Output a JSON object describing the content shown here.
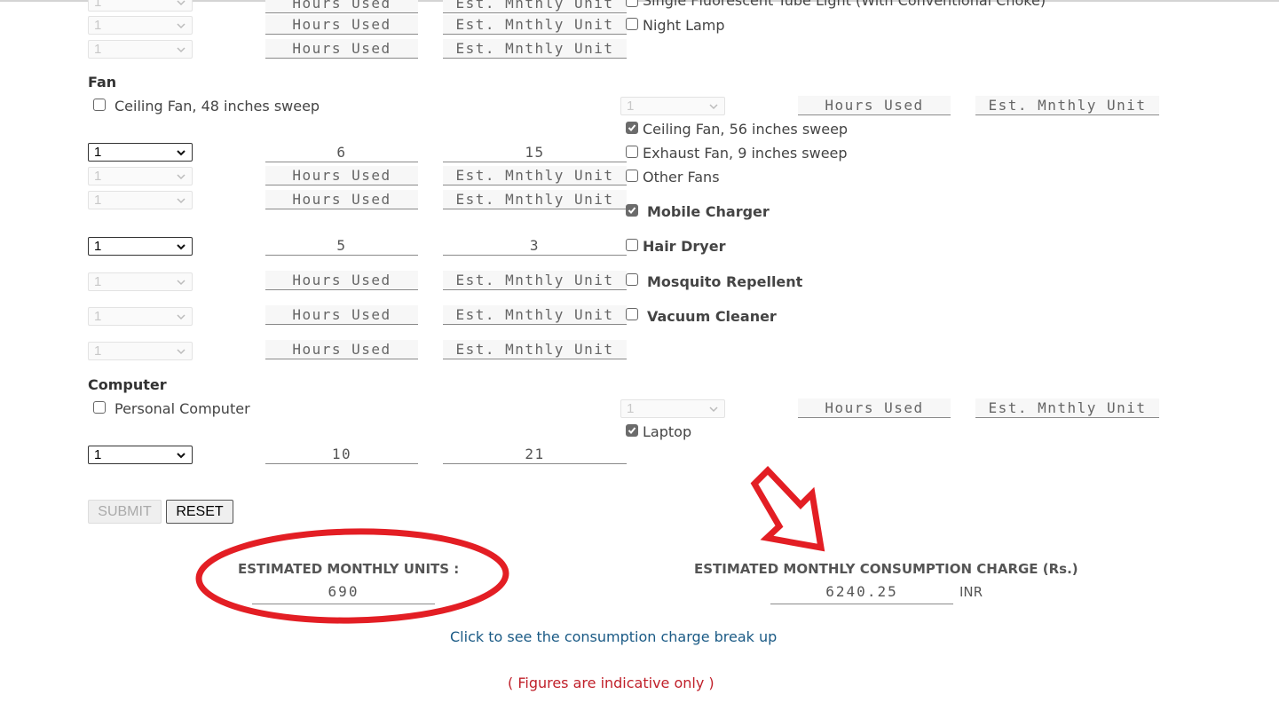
{
  "colors": {
    "annotation_red": "#e31e24",
    "link_blue": "#1a5a85",
    "note_red": "#c0202a"
  },
  "placeholders": {
    "hours": "Hours Used",
    "units": "Est. Mnthly Unit"
  },
  "top_rows": {
    "partial_label": "Single Fluorescent Tube Light (With Conventional Choke)",
    "night_lamp": "Night Lamp",
    "qty": "1"
  },
  "fan": {
    "title": "Fan",
    "items": [
      {
        "label": "Ceiling Fan, 48 inches sweep",
        "checked": false,
        "qty": "1"
      },
      {
        "label": "Ceiling Fan, 56 inches sweep",
        "checked": true,
        "qty": "1",
        "hours": "6",
        "units": "15"
      },
      {
        "label": "Exhaust Fan, 9 inches sweep",
        "checked": false,
        "qty": "1"
      },
      {
        "label": "Other Fans",
        "checked": false,
        "qty": "1"
      }
    ]
  },
  "misc": {
    "items": [
      {
        "label": "Mobile Charger",
        "checked": true,
        "qty": "1",
        "hours": "5",
        "units": "3"
      },
      {
        "label": "Hair Dryer",
        "checked": false,
        "qty": "1"
      },
      {
        "label": "Mosquito Repellent",
        "checked": false,
        "qty": "1"
      },
      {
        "label": "Vacuum Cleaner",
        "checked": false,
        "qty": "1"
      }
    ]
  },
  "computer": {
    "title": "Computer",
    "items": [
      {
        "label": "Personal Computer",
        "checked": false,
        "qty": "1"
      },
      {
        "label": "Laptop",
        "checked": true,
        "qty": "1",
        "hours": "10",
        "units": "21"
      }
    ]
  },
  "buttons": {
    "submit": "SUBMIT",
    "reset": "RESET"
  },
  "results": {
    "units_label": "ESTIMATED MONTHLY UNITS :",
    "units_value": "690",
    "charge_label": "ESTIMATED MONTHLY CONSUMPTION CHARGE (Rs.)",
    "charge_value": "6240.25",
    "currency": "INR"
  },
  "links": {
    "breakup": "Click to see the consumption charge break up"
  },
  "note": "( Figures are indicative only )"
}
